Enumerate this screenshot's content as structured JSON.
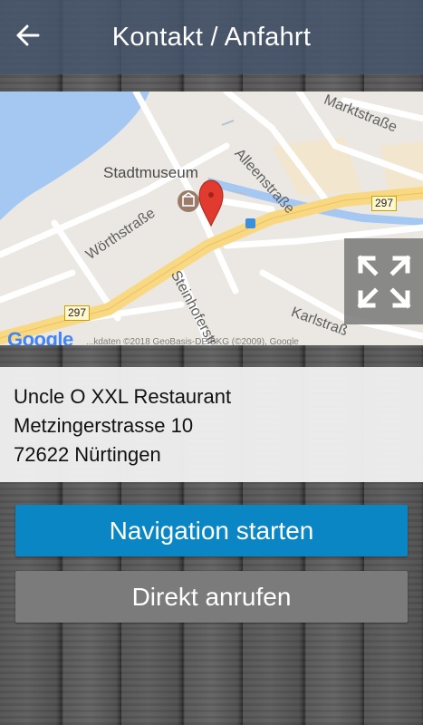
{
  "header": {
    "title": "Kontakt / Anfahrt",
    "back_icon": "arrow-left-icon"
  },
  "map": {
    "poi_name": "Stadtmuseum",
    "streets": {
      "marktstrasse": "Marktstraße",
      "alleenstrasse": "Alleenstraße",
      "woerthstrasse": "Wörthstraße",
      "steinhoferstrasse": "Steinhoferstr",
      "karlstrasse": "Karlstraß"
    },
    "route_number_1": "297",
    "route_number_2": "297",
    "provider": "Google",
    "attribution": "...kdaten ©2018 GeoBasis-DE/BKG (©2009), Google",
    "fullscreen_icon": "fullscreen-expand-icon",
    "marker_icon": "map-pin-icon",
    "museum_icon": "museum-icon",
    "colors": {
      "water": "#a5c8f2",
      "main_road": "#f9d884",
      "marker": "#e03b2e"
    }
  },
  "address": {
    "name": "Uncle O XXL Restaurant",
    "street": "Metzingerstrasse 10",
    "city": "72622 Nürtingen"
  },
  "buttons": {
    "navigate": "Navigation starten",
    "call": "Direkt anrufen"
  },
  "colors": {
    "header_bg": "#46546c",
    "nav_button": "#0a86c4",
    "call_button": "#7b7b7b"
  }
}
